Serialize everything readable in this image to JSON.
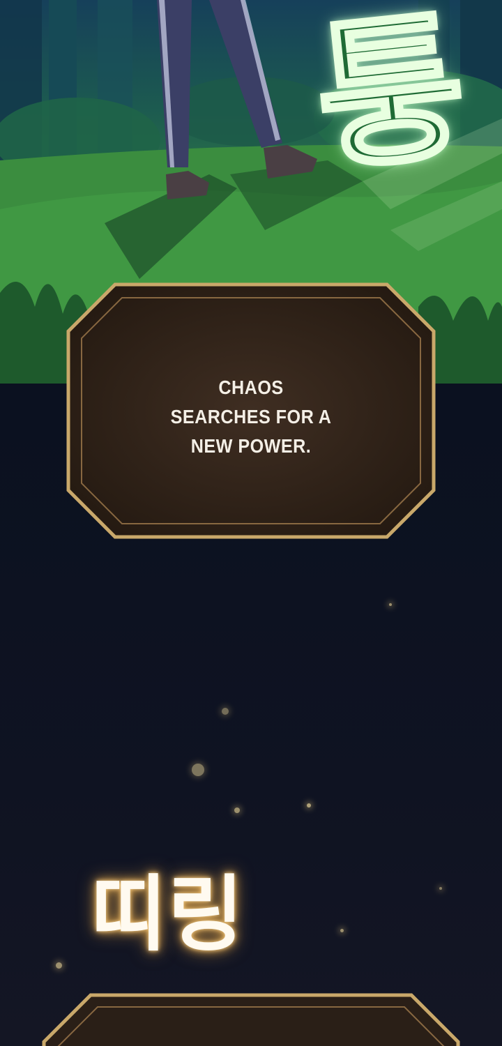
{
  "panels": {
    "forest": {
      "sfx": "퉁"
    },
    "narration_top": {
      "text": "CHAOS SEARCHES FOR A NEW POWER."
    },
    "night": {
      "sfx": "띠링"
    }
  },
  "colors": {
    "box_border": "#c9a86a",
    "box_fill": "#3a2a1e",
    "sky": "#0b1120",
    "grass": "#3a8a40",
    "sfx_glow": "#e0a54a"
  }
}
